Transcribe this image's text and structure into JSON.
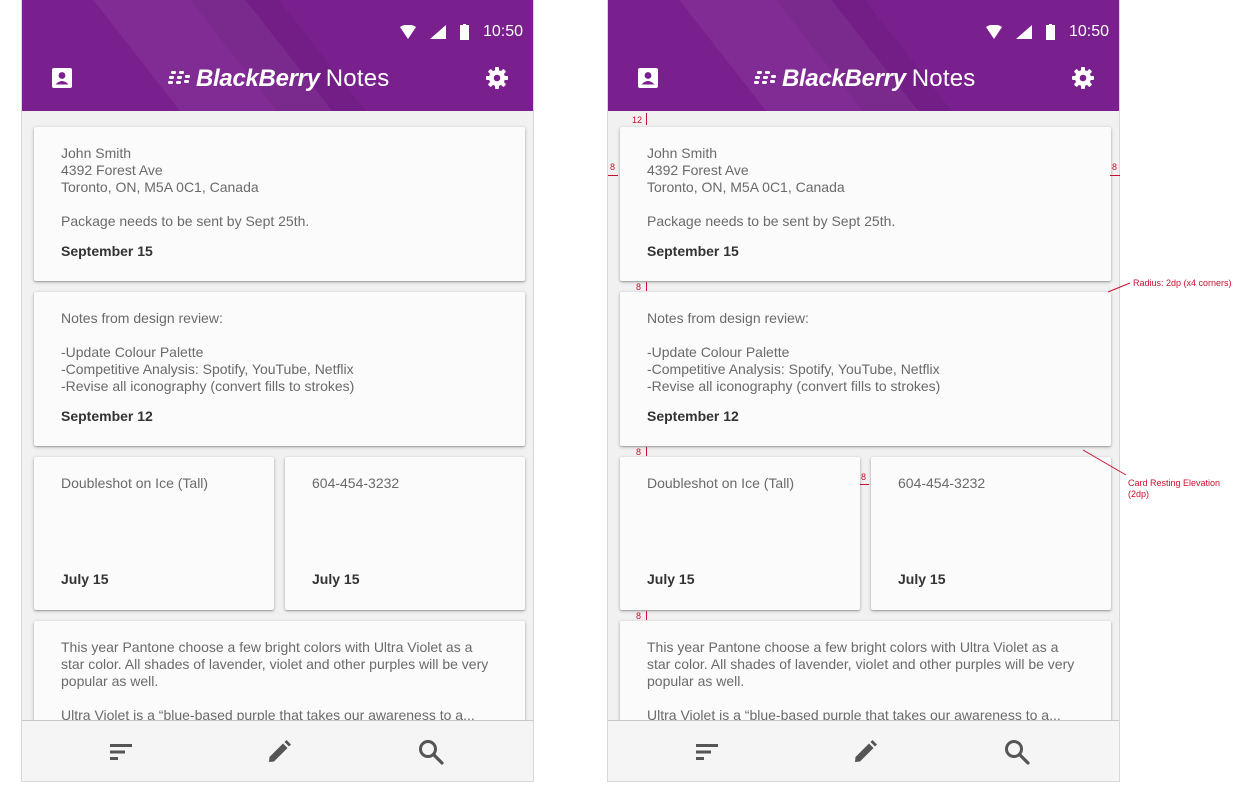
{
  "status_bar": {
    "time": "10:50",
    "wifi_icon": "wifi-icon",
    "signal_icon": "signal-icon",
    "battery_icon": "battery-icon"
  },
  "app_bar": {
    "brand": "BlackBerry",
    "title": "Notes",
    "left_icon": "contact-card-icon",
    "right_icon": "settings-gear-icon",
    "color": "#7a1f8e"
  },
  "notes": [
    {
      "lines": [
        "John Smith",
        "4392 Forest Ave",
        "Toronto, ON, M5A 0C1, Canada"
      ],
      "extra": "Package needs to be sent by Sept 25th.",
      "date": "September 15"
    },
    {
      "lines": [
        "Notes from design review:"
      ],
      "list": [
        "-Update Colour Palette",
        "-Competitive Analysis: Spotify, YouTube, Netflix",
        "-Revise all iconography (convert fills to strokes)"
      ],
      "date": "September 12"
    },
    {
      "lines": [
        "Doubleshot on Ice (Tall)"
      ],
      "date": "July 15"
    },
    {
      "lines": [
        "604-454-3232"
      ],
      "date": "July 15"
    },
    {
      "paragraph": "This year Pantone choose a few bright colors with Ultra Violet as a star color. All shades of lavender, violet and other purples will be very popular as well.",
      "paragraph2": "Ultra Violet is a “blue-based purple that takes our awareness to a..."
    }
  ],
  "bottom_bar": {
    "sort_icon": "sort-icon",
    "compose_icon": "pencil-icon",
    "search_icon": "search-icon"
  },
  "annotations": {
    "top_margin": "12",
    "side_margin": "8",
    "gap": "8",
    "radius_note": "Radius: 2dp (x4 corners)",
    "elevation_note_1": "Card Resting Elevation",
    "elevation_note_2": "(2dp)"
  }
}
